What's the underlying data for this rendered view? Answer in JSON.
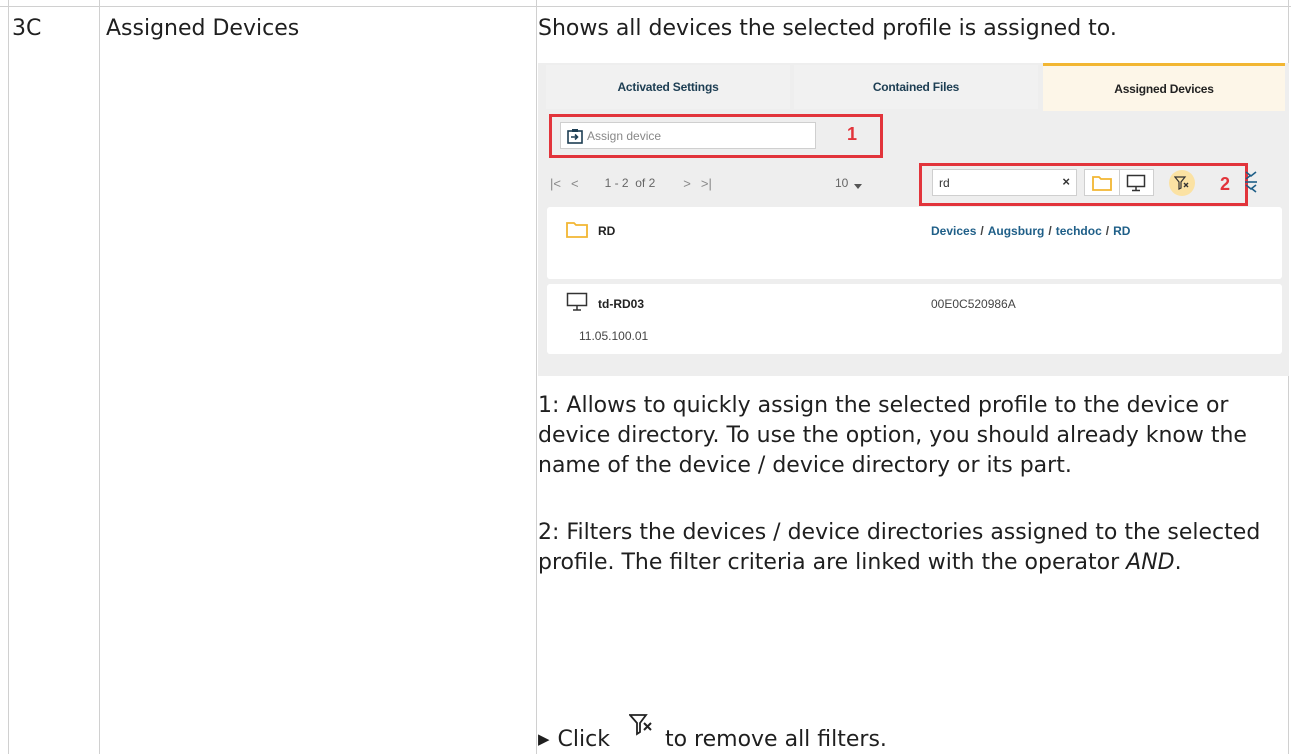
{
  "row": {
    "id": "3C",
    "name": "Assigned Devices",
    "summary": "Shows all devices the selected profile is assigned to."
  },
  "screenshot": {
    "tabs": [
      "Activated Settings",
      "Contained Files",
      "Assigned Devices"
    ],
    "active_tab": "Assigned Devices",
    "assign_placeholder": "Assign device",
    "callout_1": "1",
    "callout_2": "2",
    "pager": {
      "first": "|<",
      "prev": "<",
      "range": "1 - 2  of 2",
      "next": ">",
      "last": ">|",
      "page_size": "10"
    },
    "filter_value": "rd",
    "filter_clear": "×",
    "rows": [
      {
        "icon": "folder-icon",
        "name": "RD",
        "breadcrumb": [
          "Devices",
          "Augsburg",
          "techdoc",
          "RD"
        ],
        "breadcrumb_sep": "/"
      },
      {
        "icon": "monitor-icon",
        "name": "td-RD03",
        "mac": "00E0C520986A",
        "version": "11.05.100.01"
      }
    ],
    "colors": {
      "accent": "#f2b632",
      "callout": "#e2343b",
      "link": "#1f5f88",
      "funnel_bg": "#fbe2a3"
    }
  },
  "desc": {
    "para1": "1: Allows to quickly assign the selected profile to the device or device directory. To use the option, you should already know the name of the device / device directory or its part.",
    "para2_prefix": "2: Filters the devices / device directories assigned to the selected profile. The filter criteria are linked with the operator ",
    "para2_em": "AND",
    "para2_suffix": ".",
    "step_prefix": "Click",
    "step_suffix": "to remove all filters.",
    "step_icon": "remove-filter-icon"
  }
}
